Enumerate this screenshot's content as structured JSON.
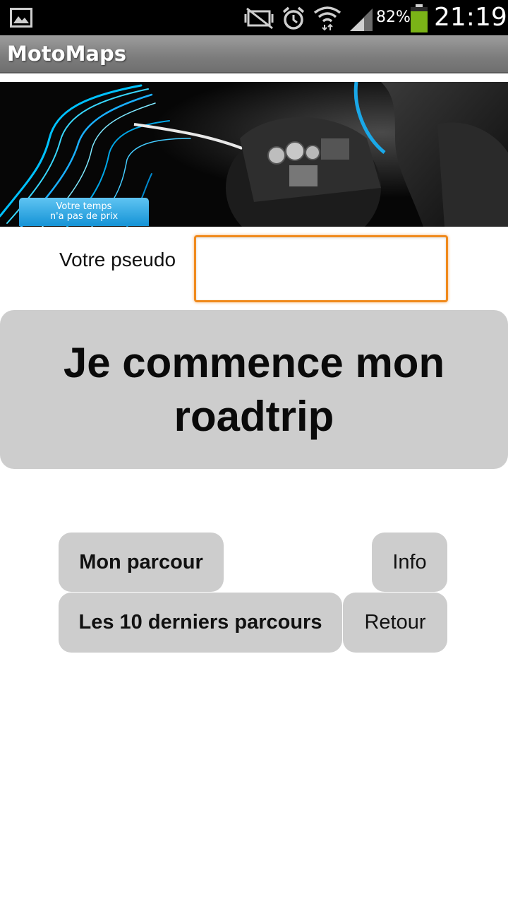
{
  "status_bar": {
    "battery": "82%",
    "time": "21:19",
    "icons": [
      "gallery-icon",
      "nfc-muted-icon",
      "alarm-icon",
      "wifi-icon",
      "signal-icon",
      "battery-icon"
    ]
  },
  "app": {
    "title": "MotoMaps"
  },
  "banner": {
    "badge_line1": "Votre temps",
    "badge_line2": "n'a pas de prix"
  },
  "form": {
    "pseudo_label": "Votre pseudo",
    "pseudo_value": "",
    "focus_color": "#f08a1d"
  },
  "buttons": {
    "start": "Je commence mon roadtrip",
    "mon_parcour": "Mon parcour",
    "info": "Info",
    "derniers": "Les 10 derniers parcours",
    "retour": "Retour"
  },
  "colors": {
    "button_bg": "#cdcdcd",
    "title_bar": "#8a8a8a",
    "status_bar": "#000000",
    "battery_green": "#7ab317"
  }
}
